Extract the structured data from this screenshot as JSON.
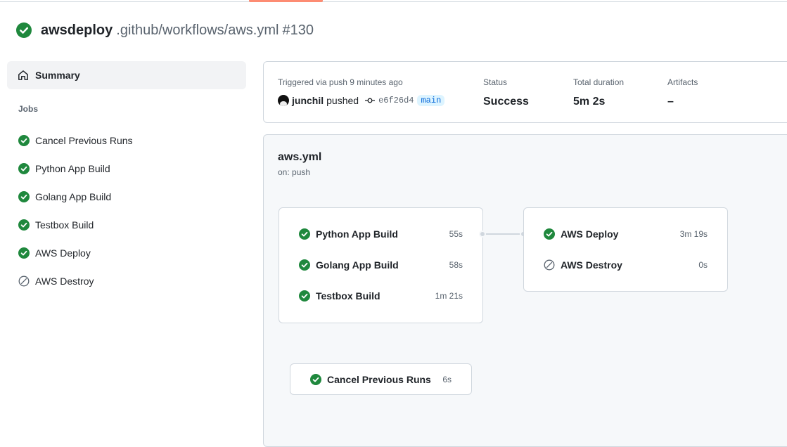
{
  "colors": {
    "success": "#1f883d",
    "skipped": "#59636e",
    "accent": "#fd8c73",
    "branch": "#0969da"
  },
  "header": {
    "repo": "awsdeploy",
    "path": ".github/workflows/aws.yml",
    "run": "#130",
    "status_icon": "check-circle-fill-icon"
  },
  "sidebar": {
    "summary_label": "Summary",
    "summary_icon": "home-icon",
    "jobs_heading": "Jobs",
    "jobs": [
      {
        "label": "Cancel Previous Runs",
        "status": "success",
        "icon": "check-circle-fill-icon"
      },
      {
        "label": "Python App Build",
        "status": "success",
        "icon": "check-circle-fill-icon"
      },
      {
        "label": "Golang App Build",
        "status": "success",
        "icon": "check-circle-fill-icon"
      },
      {
        "label": "Testbox Build",
        "status": "success",
        "icon": "check-circle-fill-icon"
      },
      {
        "label": "AWS Deploy",
        "status": "success",
        "icon": "check-circle-fill-icon"
      },
      {
        "label": "AWS Destroy",
        "status": "skipped",
        "icon": "skip-icon"
      }
    ]
  },
  "summary": {
    "triggered_label": "Triggered via push 9 minutes ago",
    "actor": "junchil",
    "verb": "pushed",
    "commit_icon": "git-commit-icon",
    "sha": "e6f26d4",
    "branch": "main",
    "status_label": "Status",
    "status_value": "Success",
    "duration_label": "Total duration",
    "duration_value": "5m 2s",
    "artifacts_label": "Artifacts",
    "artifacts_value": "–"
  },
  "graph": {
    "workflow_file": "aws.yml",
    "trigger": "on: push",
    "build_group": [
      {
        "name": "Python App Build",
        "duration": "55s",
        "status": "success"
      },
      {
        "name": "Golang App Build",
        "duration": "58s",
        "status": "success"
      },
      {
        "name": "Testbox Build",
        "duration": "1m 21s",
        "status": "success"
      }
    ],
    "deploy_group": [
      {
        "name": "AWS Deploy",
        "duration": "3m 19s",
        "status": "success"
      },
      {
        "name": "AWS Destroy",
        "duration": "0s",
        "status": "skipped"
      }
    ],
    "cancel_group": [
      {
        "name": "Cancel Previous Runs",
        "duration": "6s",
        "status": "success"
      }
    ]
  }
}
